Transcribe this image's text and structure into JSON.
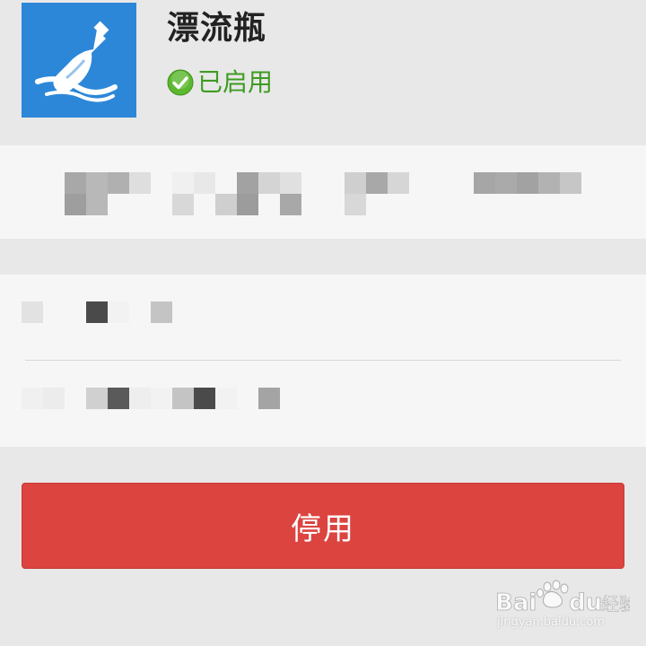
{
  "app": {
    "icon": "message-bottle-icon",
    "name": "漂流瓶",
    "status": {
      "icon": "check-circle-icon",
      "label": "已启用"
    }
  },
  "actions": {
    "disable_label": "停用"
  },
  "watermark": {
    "brand": "Baidu经验",
    "url": "jingyan.baidu.com"
  },
  "colors": {
    "icon_bg": "#2d87d8",
    "status_green": "#3f9b22",
    "disable_button": "#dc4440",
    "background": "#e8e8e8",
    "card": "#f6f6f6"
  }
}
